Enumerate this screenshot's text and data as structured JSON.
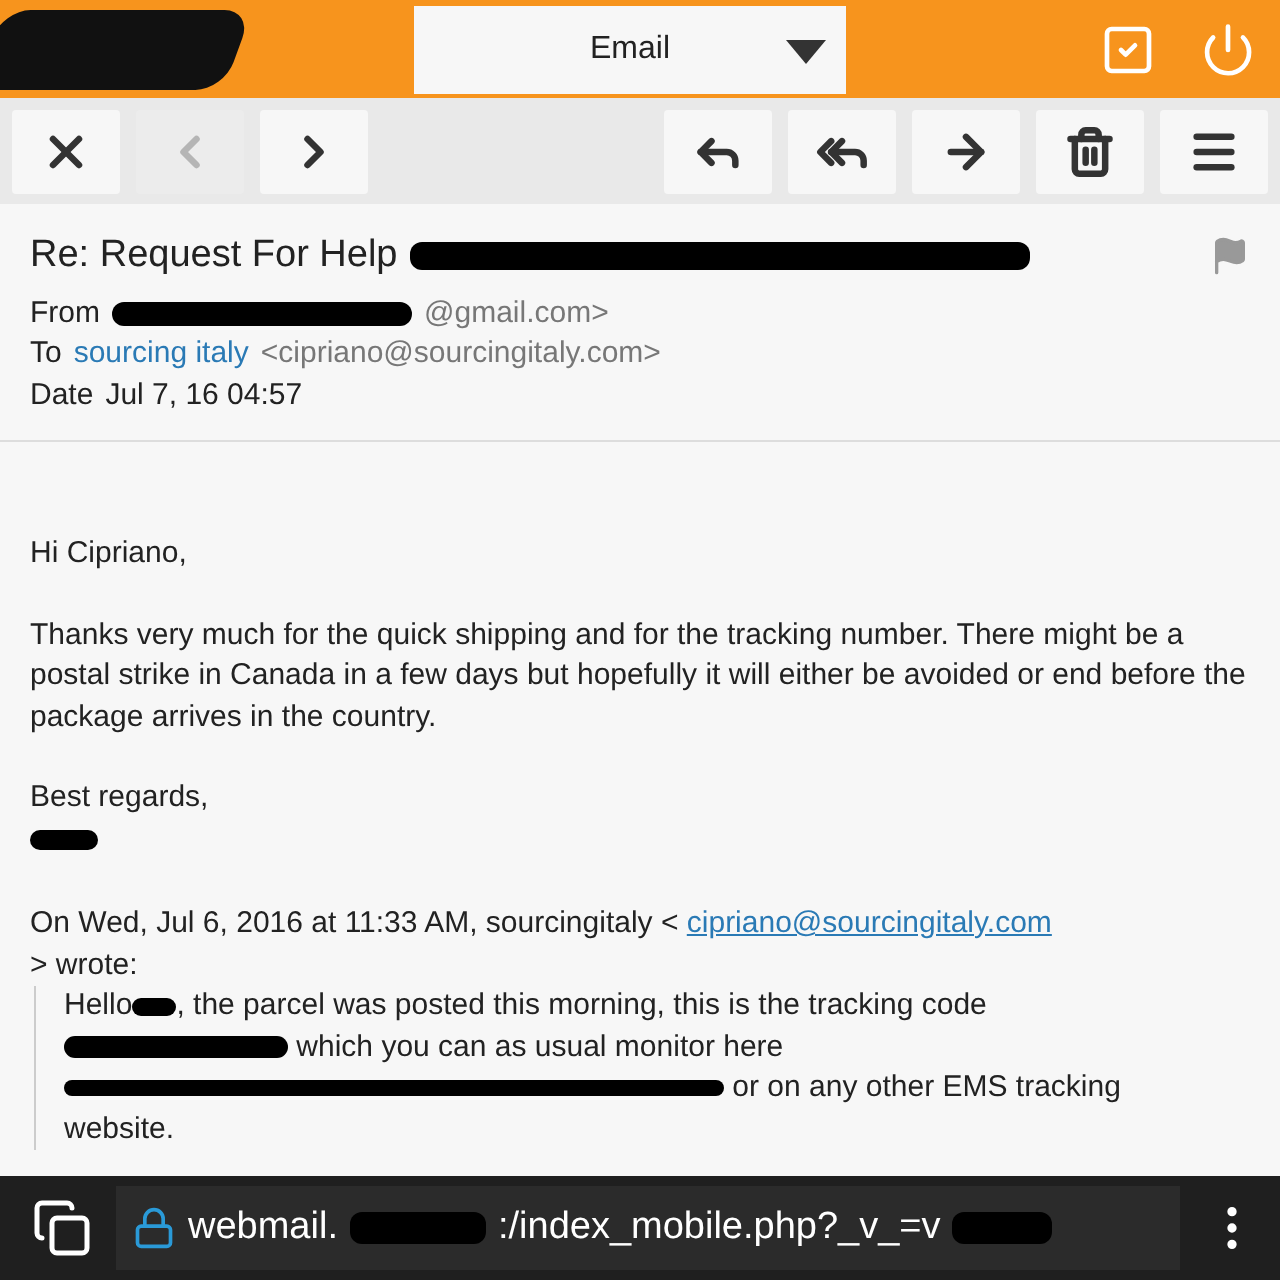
{
  "header": {
    "folder_select": "Email"
  },
  "toolbar": [
    {
      "kind": "close",
      "disabled": false
    },
    {
      "kind": "previous",
      "disabled": true
    },
    {
      "kind": "next",
      "disabled": false
    },
    {
      "kind": "reply",
      "disabled": false
    },
    {
      "kind": "reply_all",
      "disabled": false
    },
    {
      "kind": "forward",
      "disabled": false
    },
    {
      "kind": "delete",
      "disabled": false
    },
    {
      "kind": "menu",
      "disabled": false
    }
  ],
  "message": {
    "subject": "Re: Request For Help",
    "from_label": "From",
    "from_value": "@gmail.com>",
    "to_label": "To",
    "to_name": "sourcing italy",
    "to_address": "<cipriano@sourcingitaly.com>",
    "date_label": "Date",
    "date_value": "Jul 7, 16 04:57"
  },
  "body": {
    "greeting": "Hi Cipriano,",
    "paragraph": "Thanks very much for the quick shipping and for the tracking number.  There might be a postal strike in Canada in a few days but hopefully it will either be avoided or end before the package arrives in the country.",
    "closing": "Best regards,",
    "quote_intro": "On Wed, Jul 6, 2016 at 11:33 AM, sourcingitaly <",
    "quote_link": "cipriano@sourcingitaly.com",
    "quote_wrote": "> wrote:",
    "quoted_hello": "Hello",
    "quoted_line1": ", the parcel was posted this morning, this is the tracking code",
    "quoted_line2": "which you can as usual monitor here",
    "quoted_line3": "or on any other EMS tracking",
    "quoted_line4": "website."
  },
  "address_bar": {
    "url_start": "webmail.",
    "url_middle": ":/index_mobile.php?_v_=v"
  }
}
